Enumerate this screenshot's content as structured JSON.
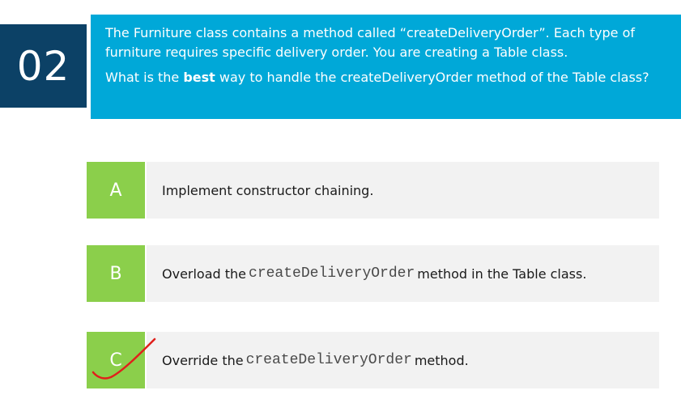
{
  "question": {
    "number": "02",
    "paragraph1": "The Furniture class contains a method called “createDeliveryOrder”. Each type of furniture requires specific delivery order. You are creating a Table class.",
    "paragraph2_before": "What is the ",
    "paragraph2_bold": "best",
    "paragraph2_after": " way to handle the createDeliveryOrder method of the Table class?"
  },
  "answers": [
    {
      "letter": "A",
      "text": "Implement constructor chaining."
    },
    {
      "letter": "B",
      "text_before": "Overload the ",
      "code": "createDeliveryOrder",
      "text_after": " method in the Table class."
    },
    {
      "letter": "C",
      "text_before": "Override the ",
      "code": "createDeliveryOrder",
      "text_after": " method."
    }
  ],
  "correct_answer_mark": {
    "icon": "checkmark-icon",
    "color": "#e0201b"
  },
  "colors": {
    "number_box": "#0c4166",
    "question_box": "#00a8d8",
    "letter_box": "#8bcf4b",
    "answer_box": "#f2f2f2"
  }
}
